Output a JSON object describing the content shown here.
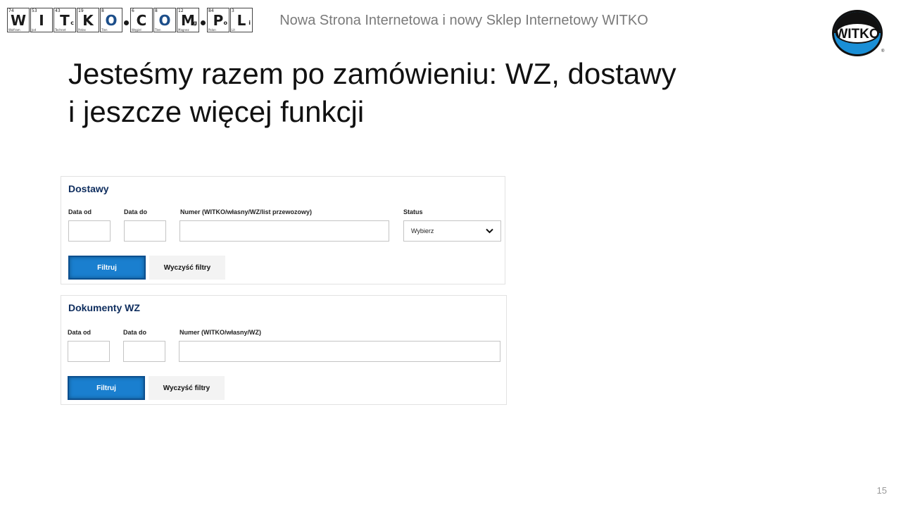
{
  "header": {
    "title": "Nowa Strona Internetowa i nowy Sklep Internetowy WITKO"
  },
  "logo_cells": [
    {
      "num": "74",
      "sym": "W",
      "sub2": "",
      "color": "dark",
      "sub": "Wolfram"
    },
    {
      "num": "53",
      "sym": "I",
      "sub2": "",
      "color": "dark",
      "sub": "Jod"
    },
    {
      "num": "43",
      "sym": "T",
      "sub2": "c",
      "color": "dark",
      "sub": "Technet"
    },
    {
      "num": "19",
      "sym": "K",
      "sub2": "",
      "color": "dark",
      "sub": "Potas"
    },
    {
      "num": "8",
      "sym": "O",
      "sub2": "",
      "color": "blue",
      "sub": "Tlen"
    },
    {
      "num": "6",
      "sym": "C",
      "sub2": "",
      "color": "dark",
      "sub": "Węgiel"
    },
    {
      "num": "8",
      "sym": "O",
      "sub2": "",
      "color": "blue",
      "sub": "Tlen"
    },
    {
      "num": "12",
      "sym": "M",
      "sub2": "g",
      "color": "dark",
      "sub": "Magnez"
    },
    {
      "num": "84",
      "sym": "P",
      "sub2": "o",
      "color": "dark",
      "sub": "Polon"
    },
    {
      "num": "3",
      "sym": "L",
      "sub2": "i",
      "color": "dark",
      "sub": "Lit"
    }
  ],
  "round_logo": {
    "text": "WITKO"
  },
  "slide": {
    "heading_line1": "Jesteśmy razem po zamówieniu: WZ, dostawy",
    "heading_line2": "i jeszcze więcej funkcji",
    "page_number": "15"
  },
  "dostawy": {
    "title": "Dostawy",
    "date_from_label": "Data od",
    "date_to_label": "Data do",
    "number_label": "Numer (WITKO/własny/WZ/list przewozowy)",
    "status_label": "Status",
    "status_value": "Wybierz",
    "date_from_value": "",
    "date_to_value": "",
    "number_value": "",
    "filter_button": "Filtruj",
    "clear_button": "Wyczyść filtry"
  },
  "wz": {
    "title": "Dokumenty WZ",
    "date_from_label": "Data od",
    "date_to_label": "Data do",
    "number_label": "Numer (WITKO/własny/WZ)",
    "date_from_value": "",
    "date_to_value": "",
    "number_value": "",
    "filter_button": "Filtruj",
    "clear_button": "Wyczyść filtry"
  },
  "colors": {
    "accent": "#1a7fcf",
    "title_navy": "#0e2d5e",
    "logo_blue": "#1c4e8a"
  }
}
